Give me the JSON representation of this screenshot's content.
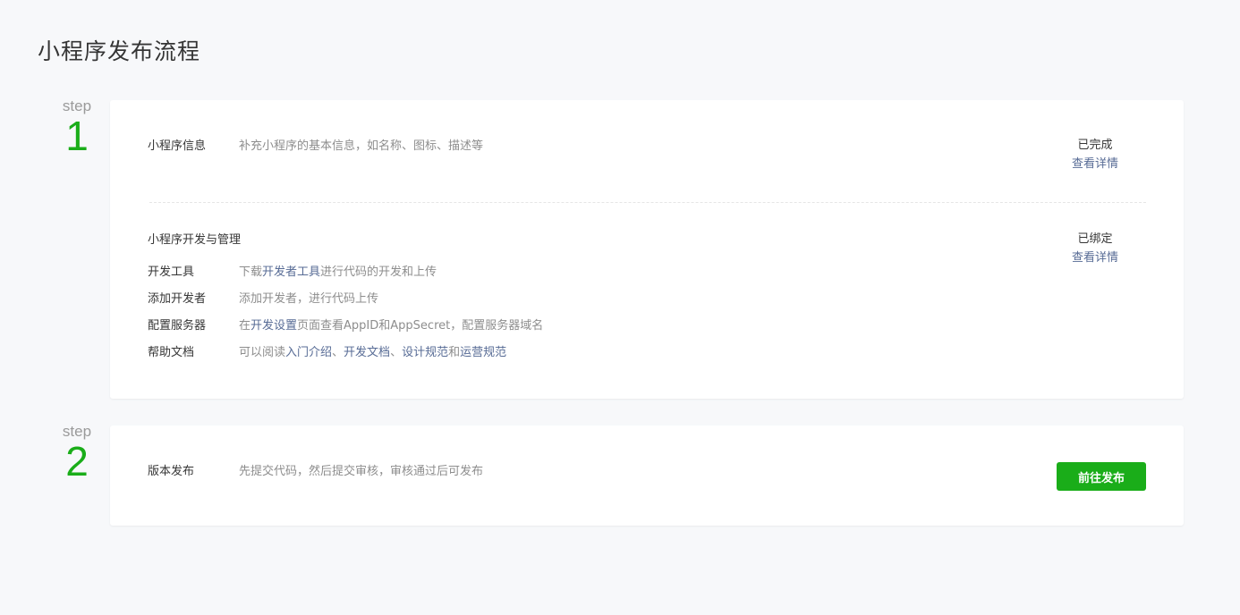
{
  "page": {
    "title": "小程序发布流程"
  },
  "steps": [
    {
      "word": "step",
      "number": "1",
      "info": {
        "label": "小程序信息",
        "desc": "补充小程序的基本信息，如名称、图标、描述等",
        "status": "已完成",
        "detail_link": "查看详情"
      },
      "dev": {
        "title": "小程序开发与管理",
        "status": "已绑定",
        "detail_link": "查看详情",
        "items": [
          {
            "label": "开发工具",
            "desc_parts": [
              "下载",
              "开发者工具",
              "进行代码的开发和上传"
            ]
          },
          {
            "label": "添加开发者",
            "desc_parts": [
              "添加开发者，进行代码上传"
            ]
          },
          {
            "label": "配置服务器",
            "desc_parts": [
              "在",
              "开发设置",
              "页面查看AppID和AppSecret，配置服务器域名"
            ]
          },
          {
            "label": "帮助文档",
            "desc_parts": [
              "可以阅读",
              "入门介绍",
              "、",
              "开发文档",
              "、",
              "设计规范",
              "和",
              "运营规范"
            ]
          }
        ]
      }
    },
    {
      "word": "step",
      "number": "2",
      "release": {
        "label": "版本发布",
        "desc": "先提交代码，然后提交审核，审核通过后可发布",
        "button": "前往发布"
      }
    }
  ],
  "colors": {
    "accent": "#1aad19",
    "link": "#576b95",
    "muted": "#8d8d8d",
    "background": "#f7f8fa"
  }
}
